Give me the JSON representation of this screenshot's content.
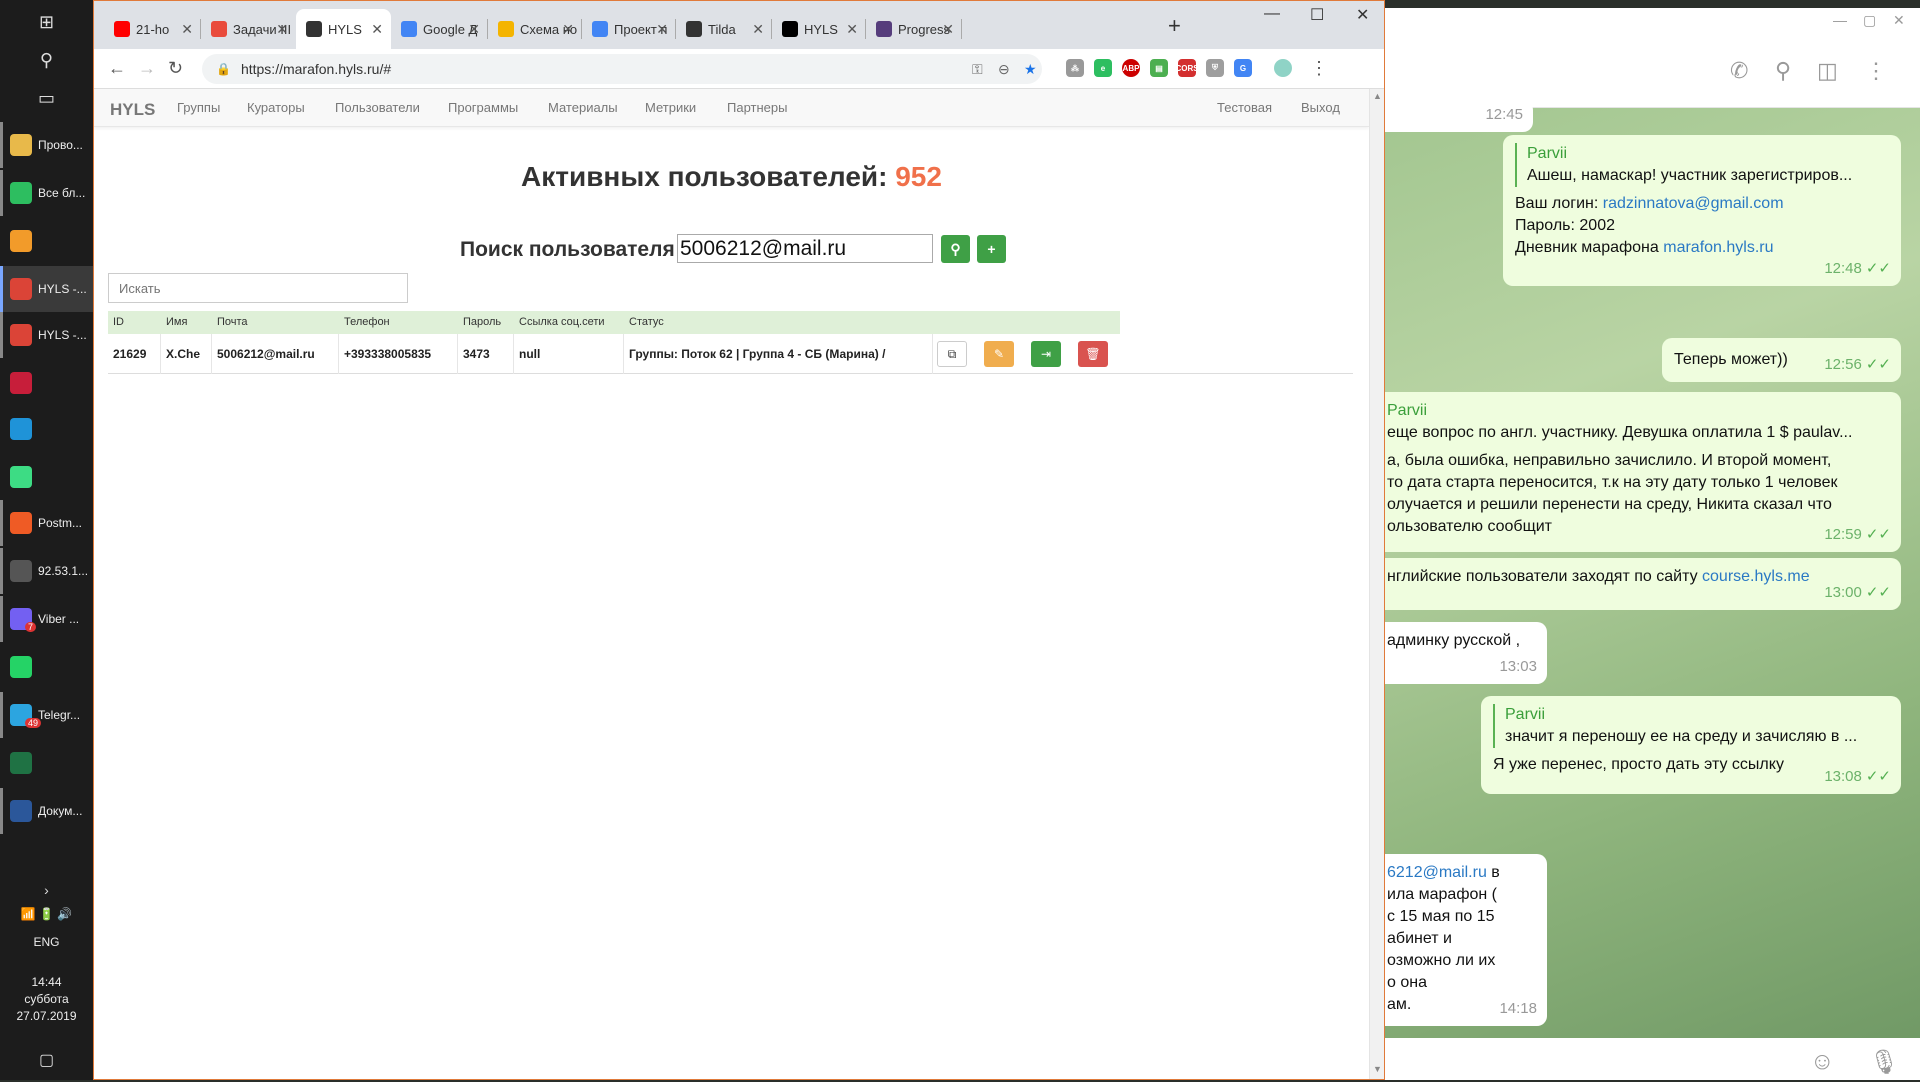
{
  "taskbar": {
    "apps": [
      {
        "label": "Прово...",
        "icon": "folder-icon",
        "color": "#e8b94a"
      },
      {
        "label": "Все бл...",
        "icon": "evernote-icon",
        "color": "#2dbe60"
      },
      {
        "label": "",
        "icon": "media-player-icon",
        "color": "#f29b2a"
      },
      {
        "label": "HYLS -...",
        "icon": "chrome-icon",
        "color": "#db4437"
      },
      {
        "label": "HYLS -...",
        "icon": "chrome-icon",
        "color": "#db4437"
      },
      {
        "label": "",
        "icon": "rubymine-icon",
        "color": "#c71e3a"
      },
      {
        "label": "",
        "icon": "webstorm-icon",
        "color": "#1f93d8"
      },
      {
        "label": "",
        "icon": "android-studio-icon",
        "color": "#3ddc84"
      },
      {
        "label": "Postm...",
        "icon": "postman-icon",
        "color": "#ef5b25"
      },
      {
        "label": "92.53.1...",
        "icon": "remote-desktop-icon",
        "color": "#555"
      },
      {
        "label": "Viber ...",
        "icon": "viber-icon",
        "color": "#7360f2"
      },
      {
        "label": "",
        "icon": "whatsapp-icon",
        "color": "#25d366"
      },
      {
        "label": "Telegr...",
        "icon": "telegram-icon",
        "color": "#2ca5e0"
      },
      {
        "label": "",
        "icon": "excel-icon",
        "color": "#1f7244"
      },
      {
        "label": "Докум...",
        "icon": "word-icon",
        "color": "#2b579a"
      }
    ],
    "viber_badge": "7",
    "telegram_badge": "49",
    "lang": "ENG",
    "time": "14:44",
    "day": "суббота",
    "date": "27.07.2019"
  },
  "browser": {
    "tabs": [
      {
        "label": "21-ho",
        "fav": "youtube-icon",
        "color": "#ff0000"
      },
      {
        "label": "Задачи III",
        "fav": "tasks-icon",
        "color": "#e94b3c"
      },
      {
        "label": "HYLS",
        "fav": "hyls-icon",
        "color": "#333"
      },
      {
        "label": "Google Д",
        "fav": "google-docs-icon",
        "color": "#4285f4"
      },
      {
        "label": "Схема но",
        "fav": "google-slides-icon",
        "color": "#f4b400"
      },
      {
        "label": "Проект п",
        "fav": "google-docs-icon",
        "color": "#4285f4"
      },
      {
        "label": "Tilda",
        "fav": "tilda-icon",
        "color": "#333"
      },
      {
        "label": "HYLS",
        "fav": "webstorm-icon",
        "color": "#000"
      },
      {
        "label": "Progress",
        "fav": "bootstrap-icon",
        "color": "#563d7c"
      }
    ],
    "url": "https://marafon.hyls.ru/#"
  },
  "app": {
    "brand": "HYLS",
    "nav": [
      "Группы",
      "Кураторы",
      "Пользователи",
      "Программы",
      "Материалы",
      "Метрики",
      "Партнеры"
    ],
    "nav_right": [
      "Тестовая",
      "Выход"
    ],
    "heading_prefix": "Активных пользователей:",
    "active_count": "952",
    "search_label": "Поиск пользователя",
    "search_value": "5006212@mail.ru",
    "filter_placeholder": "Искать",
    "columns": [
      "ID",
      "Имя",
      "Почта",
      "Телефон",
      "Пароль",
      "Ссылка соц.сети",
      "Статус"
    ],
    "row": {
      "id": "21629",
      "name": "X.Che",
      "email": "5006212@mail.ru",
      "phone": "+393338005835",
      "password": "3473",
      "social": "null",
      "status": "Группы: Поток 62 | Группа 4 - СБ (Марина) /"
    },
    "colors": {
      "count": "#f0704a",
      "green": "#3fa046",
      "orange": "#f0ad4e",
      "red": "#d9534f",
      "header_bg": "#dff0d8"
    }
  },
  "telegram": {
    "messages": [
      {
        "time": "12:45"
      },
      {
        "quote_name": "Parvii",
        "quote_text": "Ашеш, намаскар! участник зарегистриров...",
        "lines": [
          "Ваш логин: ",
          "Пароль: 2002",
          "Дневник марафона "
        ],
        "login": "radzinnatova@gmail.com",
        "site": "marafon.hyls.ru",
        "time": "12:48"
      },
      {
        "text": "Теперь может))",
        "time": "12:56"
      },
      {
        "quote_name": "Parvii",
        "quote_text": "еще вопрос по англ. участнику.  Девушка оплатила 1 $ paulav...",
        "lines": [
          "а, была ошибка, неправильно зачислило. И второй момент,",
          "то дата старта переносится, т.к на эту дату только 1 человек",
          "олучается и решили перенести на среду, Никита сказал что",
          "ользователю сообщит"
        ],
        "time": "12:59"
      },
      {
        "text": "нглийские пользователи заходят по сайту ",
        "link": "course.hyls.me",
        "time": "13:00"
      },
      {
        "text": "админку русской ,",
        "time": "13:03"
      },
      {
        "quote_name": "Parvii",
        "quote_text": "значит я переношу ее на среду и зачисляю в ...",
        "text": "Я уже перенес, просто дать эту ссылку",
        "time": "13:08"
      },
      {
        "link": "6212@mail.ru",
        "after": " в",
        "lines": [
          "ила марафон (",
          "с 15 мая по 15",
          "абинет и",
          "озможно ли их",
          "о она",
          "ам."
        ],
        "time": "14:18"
      }
    ]
  }
}
